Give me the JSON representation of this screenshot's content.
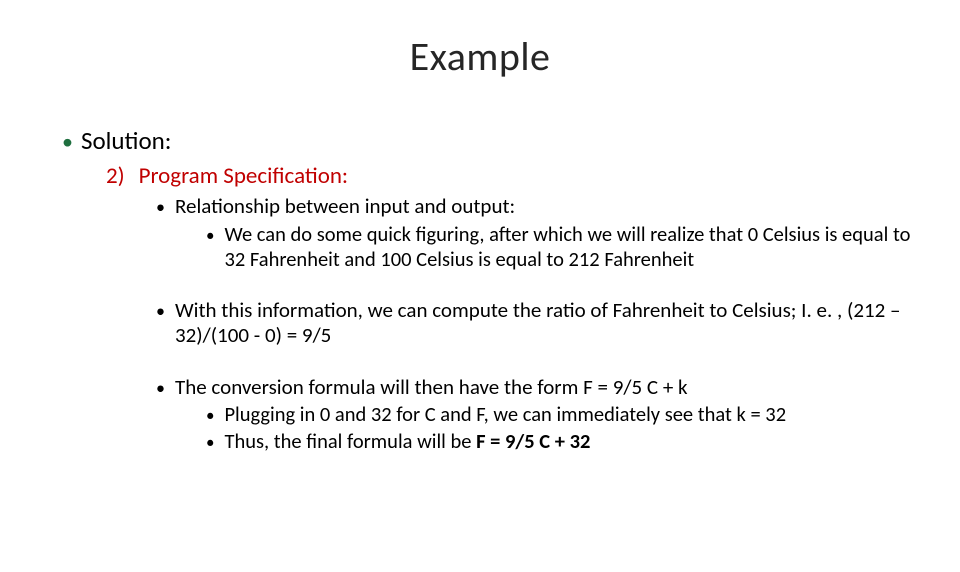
{
  "title": "Example",
  "lvl1": {
    "label": "Solution:"
  },
  "lvl2": {
    "num": "2)",
    "label": "Program Specification:"
  },
  "block1": {
    "l3": "Relationship between input and output:",
    "l4": "We can do some quick figuring, after which we will realize that 0 Celsius is equal to 32 Fahrenheit and 100 Celsius is equal to 212 Fahrenheit"
  },
  "block2": {
    "l3": "With this information, we can compute the ratio of Fahrenheit to Celsius; I. e. , (212 – 32)/(100 - 0) = 9/5"
  },
  "block3": {
    "l3": "The conversion formula will then have the form F = 9/5 C + k",
    "l4a": "Plugging in 0 and 32 for C and F, we can immediately see that k = 32",
    "l4b_prefix": "Thus, the final formula will be ",
    "l4b_bold": "F = 9/5 C + 32"
  }
}
